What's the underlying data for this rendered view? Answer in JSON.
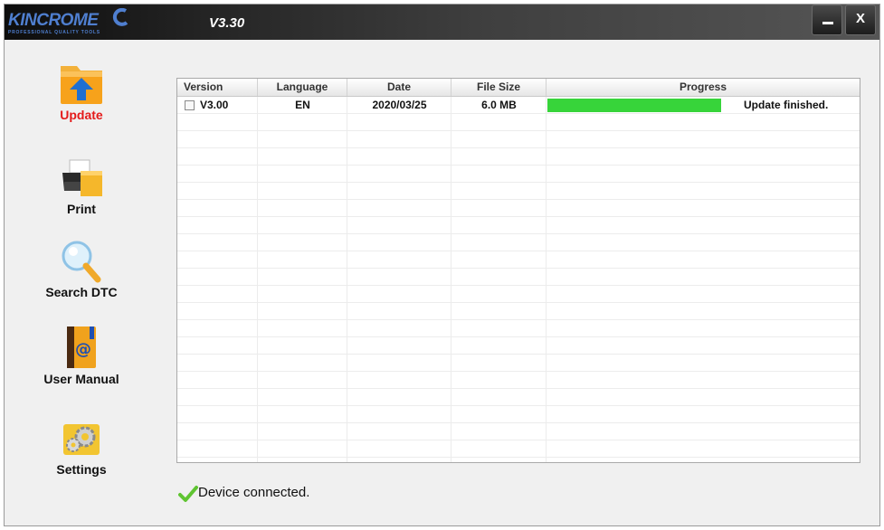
{
  "app": {
    "logo_text": "KINCROME",
    "logo_tagline": "PROFESSIONAL QUALITY TOOLS",
    "version": "V3.30",
    "minimize_icon": "minimize-icon",
    "close_label": "X"
  },
  "sidebar": {
    "items": [
      {
        "label": "Update",
        "icon": "update-folder-icon",
        "active": true
      },
      {
        "label": "Print",
        "icon": "printer-icon",
        "active": false
      },
      {
        "label": "Search DTC",
        "icon": "magnifier-icon",
        "active": false
      },
      {
        "label": "User Manual",
        "icon": "address-book-icon",
        "active": false
      },
      {
        "label": "Settings",
        "icon": "gears-icon",
        "active": false
      }
    ]
  },
  "table": {
    "columns": [
      "Version",
      "Language",
      "Date",
      "File Size",
      "Progress"
    ],
    "rows": [
      {
        "checked": false,
        "version": "V3.00",
        "language": "EN",
        "date": "2020/03/25",
        "file_size": "6.0 MB",
        "progress_fraction": 1.0,
        "progress_text": "Update finished."
      }
    ]
  },
  "status": {
    "icon": "checkmark-icon",
    "text": "Device connected."
  },
  "colors": {
    "active_label": "#e41a1a",
    "progress_fill": "#37d43a",
    "logo_blue": "#4f7fd0",
    "check_green": "#5fc431"
  }
}
